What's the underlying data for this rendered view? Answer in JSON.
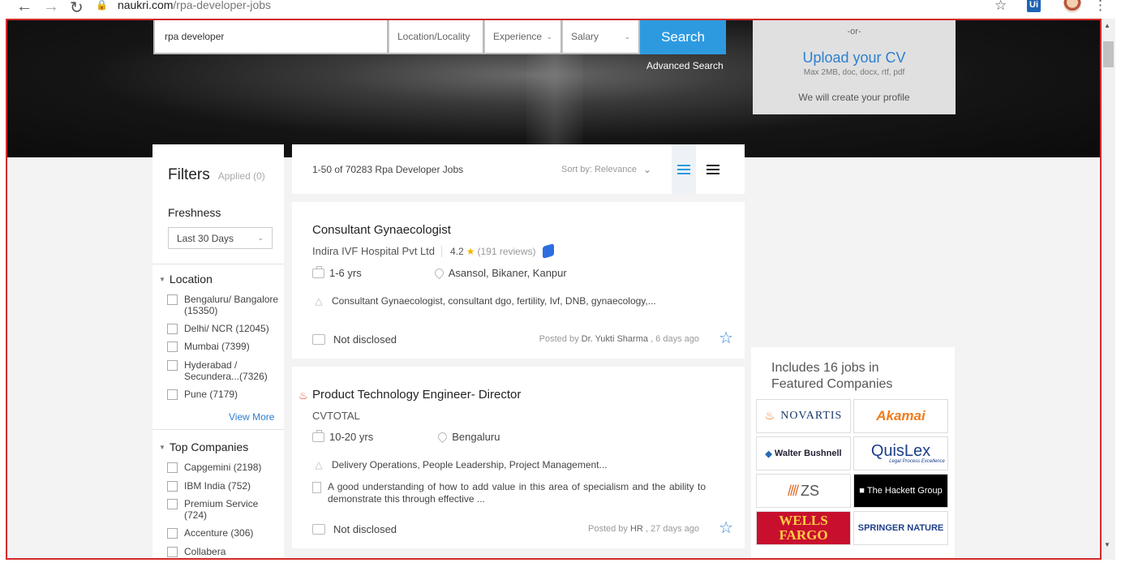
{
  "browser": {
    "url_domain": "naukri.com",
    "url_path": "/rpa-developer-jobs",
    "back_icon": "←",
    "forward_icon": "→",
    "reload_icon": "↻",
    "lock_icon": "🔒",
    "bookmark_icon": "☆",
    "ext_label": "Ui",
    "menu_icon": "⋮"
  },
  "search": {
    "keyword": "rpa developer",
    "location_placeholder": "Location/Locality",
    "experience_label": "Experience",
    "salary_label": "Salary",
    "button_label": "Search",
    "advanced_label": "Advanced Search",
    "caret": "⌄"
  },
  "upload": {
    "or": "-or-",
    "title": "Upload your CV",
    "formats": "Max 2MB, doc, docx, rtf, pdf",
    "create": "We will create your profile"
  },
  "filters": {
    "title": "Filters",
    "applied": "Applied (0)",
    "freshness_label": "Freshness",
    "freshness_value": "Last 30 Days",
    "location_label": "Location",
    "locations": [
      "Bengaluru/ Bangalore (15350)",
      "Delhi/ NCR (12045)",
      "Mumbai (7399)",
      "Hyderabad / Secundera...(7326)",
      "Pune (7179)"
    ],
    "view_more": "View More",
    "companies_label": "Top Companies",
    "companies": [
      "Capgemini (2198)",
      "IBM India (752)",
      "Premium Service (724)",
      "Accenture (306)",
      "Collabera"
    ]
  },
  "list": {
    "count": "1-50 of 70283 Rpa Developer Jobs",
    "sort": "Sort by: Relevance",
    "colors": {
      "accent": "#2d9ae0",
      "link": "#2d7fd0"
    }
  },
  "jobs": [
    {
      "title": "Consultant Gynaecologist",
      "company": "Indira IVF Hospital Pvt Ltd",
      "rating": "4.2",
      "reviews": "(191 reviews)",
      "experience": "1-6 yrs",
      "location": "Asansol, Bikaner, Kanpur",
      "skills": "Consultant Gynaecologist, consultant dgo, fertility, Ivf, DNB, gynaecology,...",
      "salary": "Not disclosed",
      "posted_prefix": "Posted by",
      "posted_by": "Dr. Yukti Sharma",
      "posted_ago": ", 6 days ago"
    },
    {
      "title": "Product Technology Engineer- Director",
      "company": "CVTOTAL",
      "experience": "10-20 yrs",
      "location": "Bengaluru",
      "skills": "Delivery Operations, People Leadership, Project Management...",
      "description": "A good understanding of how to add value in this area of specialism and the ability to demonstrate this through effective ...",
      "salary": "Not disclosed",
      "posted_prefix": "Posted by",
      "posted_by": "HR",
      "posted_ago": ", 27 days ago"
    }
  ],
  "featured": {
    "title": "Includes 16 jobs in Featured Companies",
    "logos": [
      "NOVARTIS",
      "Akamai",
      "Walter Bushnell",
      "QuisLex",
      "ZS",
      "The Hackett Group",
      "WELLS FARGO",
      "SPRINGER NATURE"
    ],
    "quislex_tag": "Legal Process Excellence"
  }
}
